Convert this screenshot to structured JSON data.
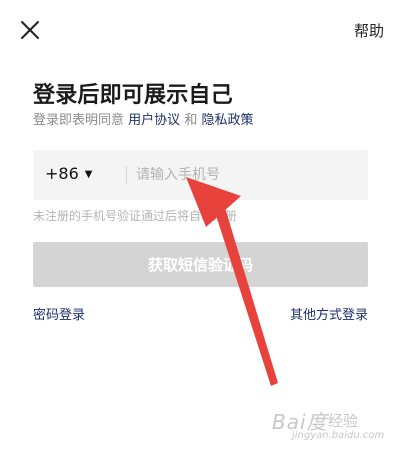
{
  "topbar": {
    "close_icon": "close-icon",
    "help_label": "帮助"
  },
  "title": "登录后即可展示自己",
  "subtitle": {
    "prefix": "登录即表明同意",
    "user_agreement": "用户协议",
    "and": "和",
    "privacy_policy": "隐私政策"
  },
  "phone": {
    "country_code": "+86",
    "caret_icon": "caret-down-icon",
    "value": "",
    "placeholder": "请输入手机号"
  },
  "hint": "未注册的手机号验证通过后将自动注册",
  "sms_button": "获取短信验证码",
  "links": {
    "password_login": "密码登录",
    "other_login": "其他方式登录"
  },
  "watermark": {
    "logo": "Bai度",
    "text": "经验",
    "url": "jingyan.baidu.com"
  },
  "colors": {
    "link": "#1f2f6d",
    "button_disabled": "#d4d4d4",
    "arrow": "#e8423c"
  }
}
